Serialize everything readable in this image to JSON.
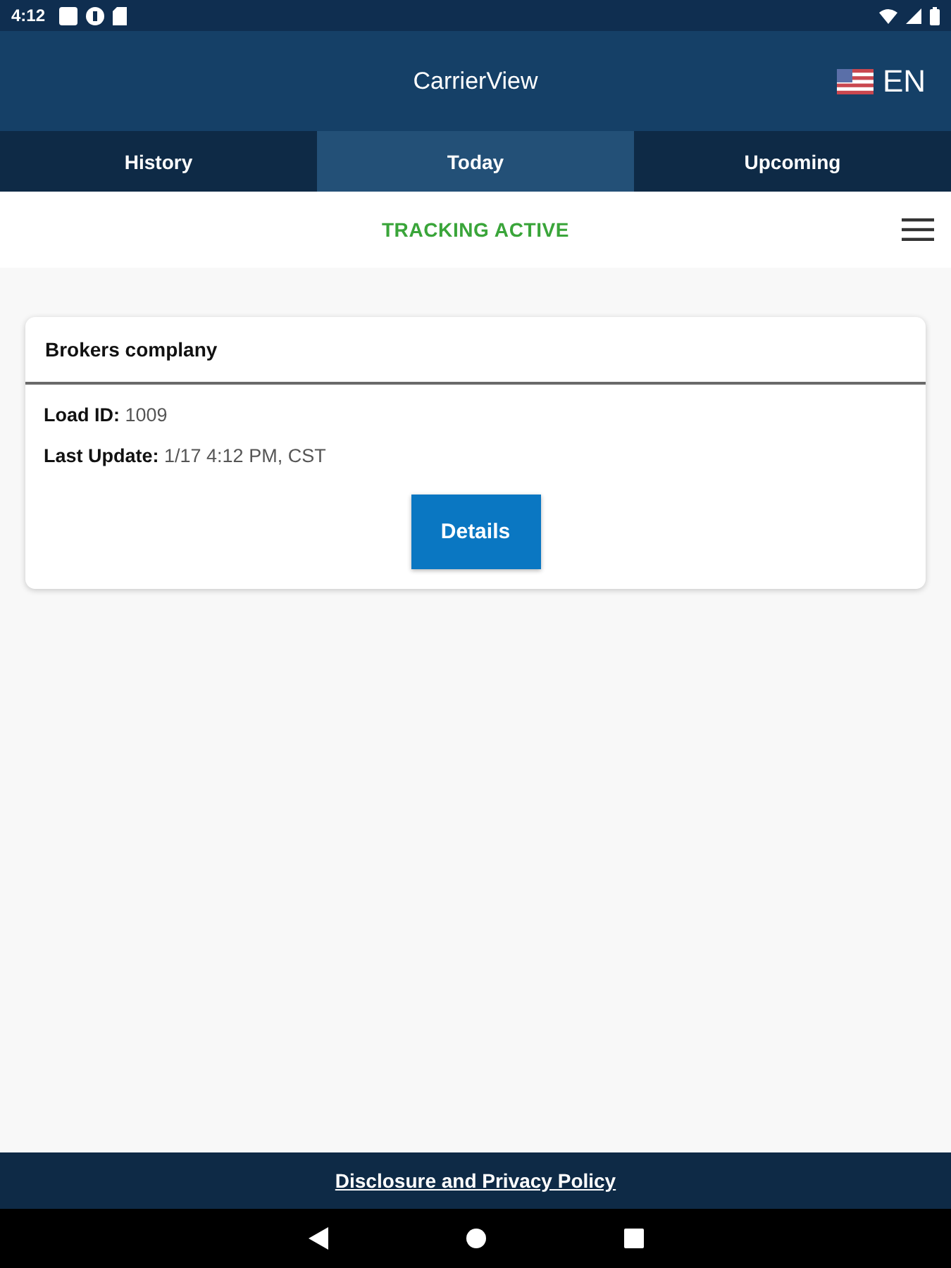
{
  "status_bar": {
    "time": "4:12"
  },
  "header": {
    "title": "CarrierView",
    "language": "EN"
  },
  "tabs": [
    {
      "label": "History",
      "selected": false
    },
    {
      "label": "Today",
      "selected": true
    },
    {
      "label": "Upcoming",
      "selected": false
    }
  ],
  "tracking": {
    "status": "TRACKING ACTIVE",
    "active": true
  },
  "loads": [
    {
      "broker": "Brokers complany",
      "fields": [
        {
          "label": "Load ID:",
          "value": "1009"
        },
        {
          "label": "Last Update:",
          "value": "1/17 4:12 PM, CST"
        }
      ],
      "button": "Details"
    }
  ],
  "footer": {
    "link": "Disclosure and Privacy Policy"
  }
}
